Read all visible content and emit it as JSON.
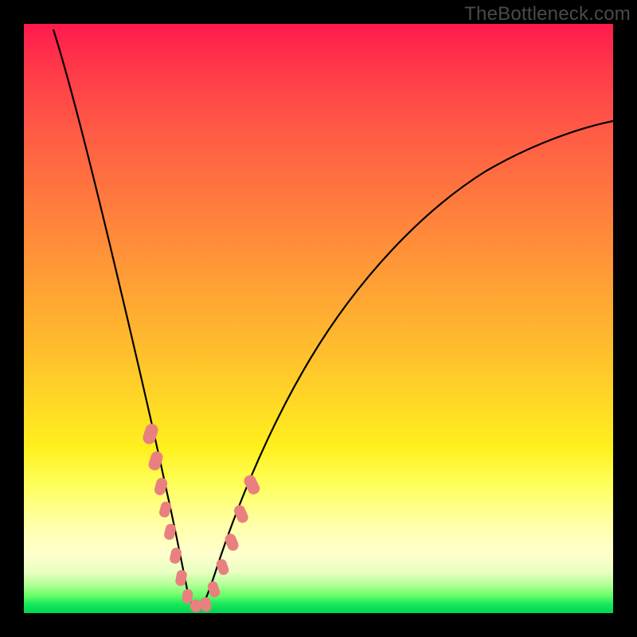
{
  "watermark": "TheBottleneck.com",
  "chart_data": {
    "type": "line",
    "title": "",
    "xlabel": "",
    "ylabel": "",
    "xlim": [
      0,
      100
    ],
    "ylim": [
      0,
      100
    ],
    "grid": false,
    "legend": false,
    "annotations": [],
    "series": [
      {
        "name": "bottleneck-curve",
        "color": "#000000",
        "x": [
          5,
          8,
          11,
          14,
          17,
          19,
          21,
          22.5,
          24,
          25.5,
          27,
          28.5,
          30,
          34,
          40,
          48,
          56,
          64,
          72,
          80,
          88,
          96,
          100
        ],
        "y": [
          99,
          88,
          76,
          64,
          51,
          40,
          30,
          22,
          14,
          8,
          3,
          1,
          2,
          8,
          20,
          35,
          48,
          58,
          66,
          72,
          77,
          81,
          83
        ]
      }
    ],
    "markers": [
      {
        "name": "highlight-points",
        "color": "#e98080",
        "shape": "rounded-square",
        "x": [
          21.0,
          22.0,
          22.8,
          23.5,
          24.2,
          25.0,
          25.8,
          26.6,
          27.4,
          28.2,
          29.0,
          30.0,
          31.0,
          32.0,
          33.0
        ],
        "y": [
          30.0,
          25.0,
          20.0,
          16.0,
          12.0,
          8.0,
          5.0,
          2.5,
          1.2,
          1.0,
          1.5,
          3.0,
          6.0,
          10.0,
          15.0
        ]
      }
    ],
    "vertex": {
      "x": 28,
      "y": 1
    }
  },
  "colors": {
    "background_frame": "#000000",
    "curve": "#000000",
    "marker": "#e98080",
    "watermark": "#4a4a4a"
  }
}
